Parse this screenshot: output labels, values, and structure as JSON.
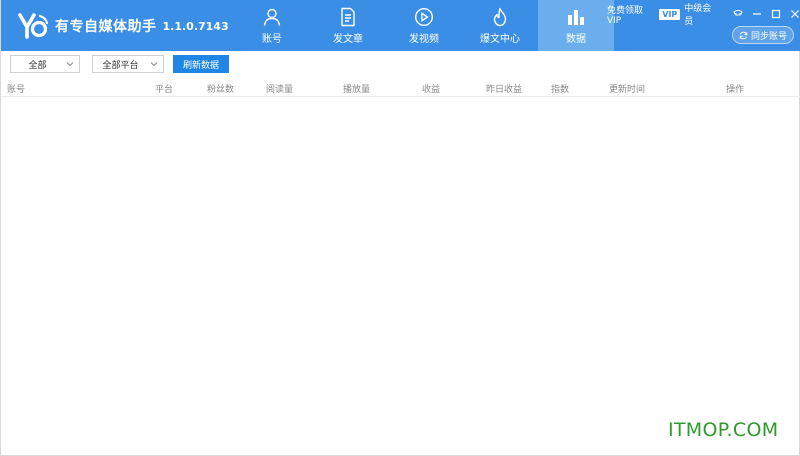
{
  "header": {
    "app_name": "有专自媒体助手",
    "version": "1.1.0.7143",
    "nav": [
      {
        "label": "账号",
        "icon": "user-icon"
      },
      {
        "label": "发文章",
        "icon": "document-icon"
      },
      {
        "label": "发视频",
        "icon": "play-icon"
      },
      {
        "label": "爆文中心",
        "icon": "flame-icon"
      },
      {
        "label": "数据",
        "icon": "bar-chart-icon",
        "active": true
      }
    ],
    "vip_link": "免费领取VIP",
    "vip_badge": "VIP",
    "member_level": "中级会员",
    "sync_label": "同步账号"
  },
  "toolbar": {
    "account_filter": "全部",
    "platform_filter": "全部平台",
    "refresh_label": "刷新数据"
  },
  "table": {
    "columns": [
      "账号",
      "平台",
      "粉丝数",
      "阅读量",
      "播放量",
      "收益",
      "昨日收益",
      "指数",
      "更新时间",
      "操作"
    ],
    "rows": []
  },
  "watermark": "ITMOP.COM",
  "colors": {
    "header_bg": "#3a8ee6",
    "nav_active_bg": "#6aaeee",
    "primary_button": "#1f86e6",
    "watermark": "#2e9a2e"
  }
}
